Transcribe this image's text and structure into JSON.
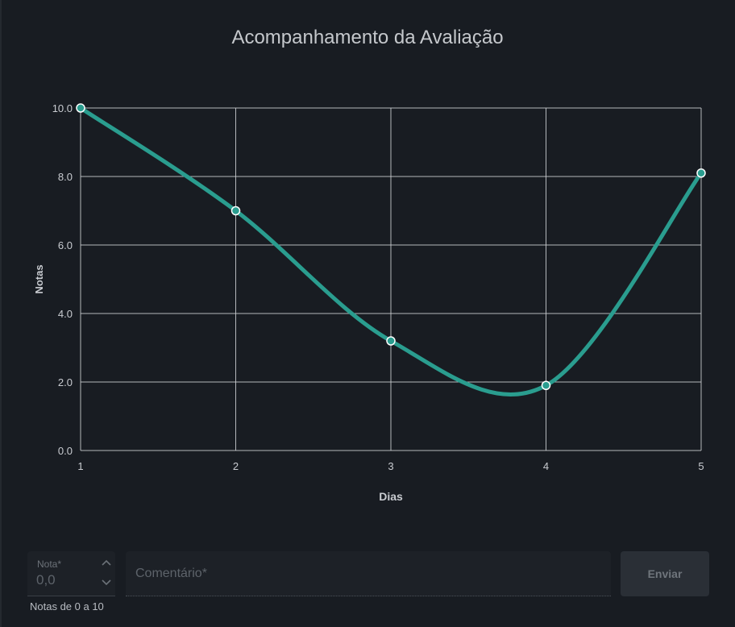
{
  "chart_data": {
    "type": "line",
    "title": "Acompanhamento da Avaliação",
    "xlabel": "Dias",
    "ylabel": "Notas",
    "x": [
      1,
      2,
      3,
      4,
      5
    ],
    "y": [
      10.0,
      7.0,
      3.2,
      1.9,
      8.1
    ],
    "x_ticks": [
      "1",
      "2",
      "3",
      "4",
      "5"
    ],
    "y_ticks": [
      "0.0",
      "2.0",
      "4.0",
      "6.0",
      "8.0",
      "10.0"
    ],
    "ylim": [
      0,
      10
    ],
    "xlim": [
      1,
      5
    ],
    "grid": true,
    "smooth": true,
    "line_color": "#2a9d8f",
    "point_color": "#2a9d8f",
    "grid_color": "#d0d3d6"
  },
  "form": {
    "nota_label": "Nota*",
    "nota_value": "0,0",
    "nota_helper": "Notas de 0 a 10",
    "comment_placeholder": "Comentário*",
    "send_label": "Enviar"
  }
}
